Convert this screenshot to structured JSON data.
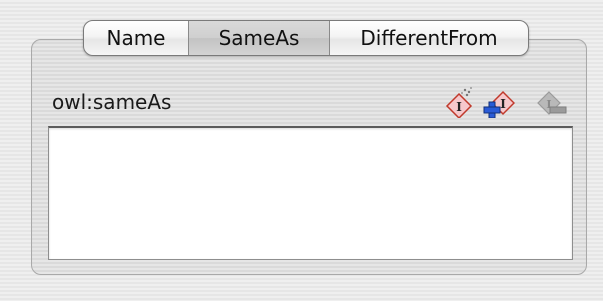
{
  "tabs": [
    {
      "label": "Name",
      "selected": false
    },
    {
      "label": "SameAs",
      "selected": true
    },
    {
      "label": "DifferentFrom",
      "selected": false
    }
  ],
  "property": {
    "label": "owl:sameAs"
  },
  "toolbar": {
    "icons": [
      "create-instance-icon",
      "add-instance-icon",
      "remove-instance-icon"
    ],
    "remove_disabled": true
  },
  "list": {
    "items": []
  },
  "colors": {
    "icon_pink": "#f6c8cc",
    "icon_red": "#c0392b",
    "icon_blue": "#2a5bd7",
    "icon_disabled": "#9b9b9b"
  }
}
